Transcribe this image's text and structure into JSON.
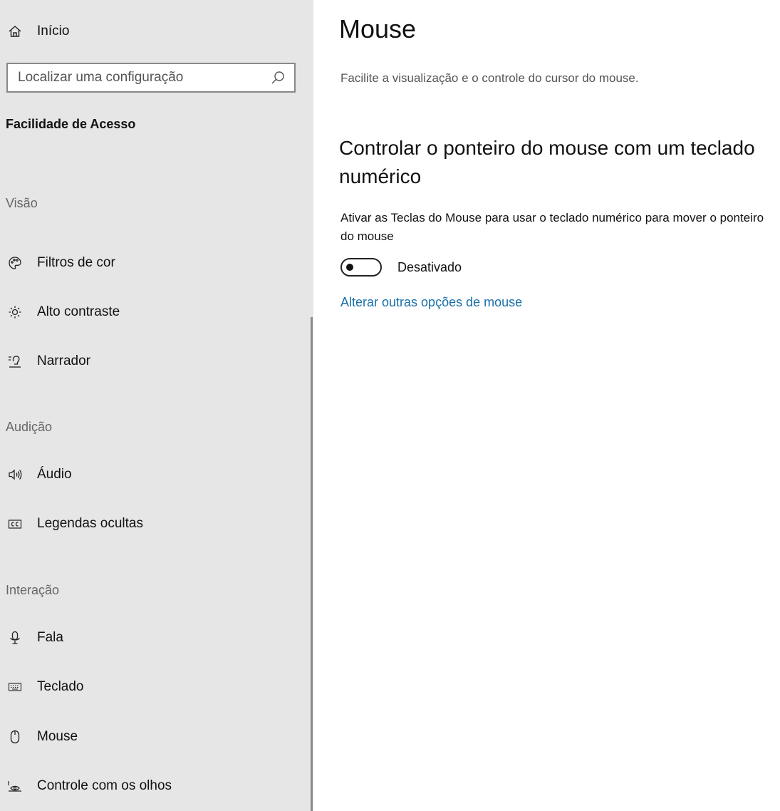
{
  "sidebar": {
    "home_label": "Início",
    "search_placeholder": "Localizar uma configuração",
    "section_title": "Facilidade de Acesso",
    "groups": {
      "vision": {
        "heading": "Visão",
        "items": [
          {
            "label": "Filtros de cor",
            "icon": "color-filter-icon"
          },
          {
            "label": "Alto contraste",
            "icon": "high-contrast-icon"
          },
          {
            "label": "Narrador",
            "icon": "narrator-icon"
          }
        ]
      },
      "hearing": {
        "heading": "Audição",
        "items": [
          {
            "label": "Áudio",
            "icon": "audio-icon"
          },
          {
            "label": "Legendas ocultas",
            "icon": "closed-captions-icon"
          }
        ]
      },
      "interaction": {
        "heading": "Interação",
        "items": [
          {
            "label": "Fala",
            "icon": "microphone-icon"
          },
          {
            "label": "Teclado",
            "icon": "keyboard-icon"
          },
          {
            "label": "Mouse",
            "icon": "mouse-icon"
          },
          {
            "label": "Controle com os olhos",
            "icon": "eye-control-icon"
          }
        ]
      }
    }
  },
  "main": {
    "title": "Mouse",
    "subtitle": "Facilite a visualização e o controle do cursor do mouse.",
    "section_heading": "Controlar o ponteiro do mouse com um teclado numérico",
    "toggle_description": "Ativar as Teclas do Mouse para usar o teclado numérico para mover o ponteiro do mouse",
    "toggle_state": "Desativado",
    "toggle_on": false,
    "link_text": "Alterar outras opções de mouse",
    "link_color": "#1a6fa8"
  }
}
